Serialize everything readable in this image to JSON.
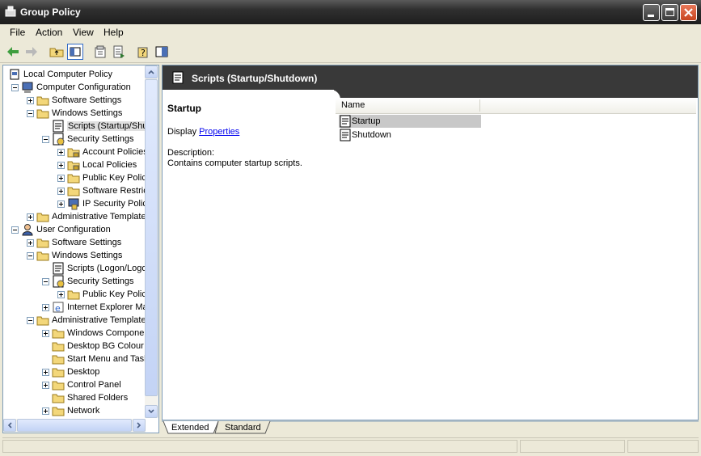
{
  "window": {
    "title": "Group Policy"
  },
  "menu": [
    "File",
    "Action",
    "View",
    "Help"
  ],
  "tree": [
    {
      "label": "Local Computer Policy",
      "icon": "computer-policy-icon",
      "depth": 0,
      "expander": "none"
    },
    {
      "label": "Computer Configuration",
      "icon": "computer-icon",
      "depth": 1,
      "expander": "minus"
    },
    {
      "label": "Software Settings",
      "icon": "folder-icon",
      "depth": 2,
      "expander": "plus"
    },
    {
      "label": "Windows Settings",
      "icon": "folder-icon",
      "depth": 2,
      "expander": "minus"
    },
    {
      "label": "Scripts (Startup/Shutdown)",
      "icon": "script-icon",
      "depth": 3,
      "expander": "none",
      "selected": true
    },
    {
      "label": "Security Settings",
      "icon": "security-icon",
      "depth": 3,
      "expander": "minus"
    },
    {
      "label": "Account Policies",
      "icon": "folder-lock-icon",
      "depth": 4,
      "expander": "plus"
    },
    {
      "label": "Local Policies",
      "icon": "folder-lock-icon",
      "depth": 4,
      "expander": "plus"
    },
    {
      "label": "Public Key Policies",
      "icon": "folder-icon",
      "depth": 4,
      "expander": "plus"
    },
    {
      "label": "Software Restriction Policies",
      "icon": "folder-icon",
      "depth": 4,
      "expander": "plus"
    },
    {
      "label": "IP Security Policies",
      "icon": "ip-security-icon",
      "depth": 4,
      "expander": "plus"
    },
    {
      "label": "Administrative Templates",
      "icon": "folder-icon",
      "depth": 2,
      "expander": "plus"
    },
    {
      "label": "User Configuration",
      "icon": "user-icon",
      "depth": 1,
      "expander": "minus"
    },
    {
      "label": "Software Settings",
      "icon": "folder-icon",
      "depth": 2,
      "expander": "plus"
    },
    {
      "label": "Windows Settings",
      "icon": "folder-icon",
      "depth": 2,
      "expander": "minus"
    },
    {
      "label": "Scripts (Logon/Logoff)",
      "icon": "script-icon",
      "depth": 3,
      "expander": "none"
    },
    {
      "label": "Security Settings",
      "icon": "security-icon",
      "depth": 3,
      "expander": "minus"
    },
    {
      "label": "Public Key Policies",
      "icon": "folder-icon",
      "depth": 4,
      "expander": "plus"
    },
    {
      "label": "Internet Explorer Maintenance",
      "icon": "ie-icon",
      "depth": 3,
      "expander": "plus"
    },
    {
      "label": "Administrative Templates",
      "icon": "folder-icon",
      "depth": 2,
      "expander": "minus"
    },
    {
      "label": "Windows Components",
      "icon": "folder-icon",
      "depth": 3,
      "expander": "plus"
    },
    {
      "label": "Desktop BG Colour",
      "icon": "folder-icon",
      "depth": 3,
      "expander": "none"
    },
    {
      "label": "Start Menu and Taskbar",
      "icon": "folder-icon",
      "depth": 3,
      "expander": "none"
    },
    {
      "label": "Desktop",
      "icon": "folder-icon",
      "depth": 3,
      "expander": "plus"
    },
    {
      "label": "Control Panel",
      "icon": "folder-icon",
      "depth": 3,
      "expander": "plus"
    },
    {
      "label": "Shared Folders",
      "icon": "folder-icon",
      "depth": 3,
      "expander": "none"
    },
    {
      "label": "Network",
      "icon": "folder-icon",
      "depth": 3,
      "expander": "plus"
    }
  ],
  "detail": {
    "header_title": "Scripts (Startup/Shutdown)",
    "section_title": "Startup",
    "display_prefix": "Display",
    "display_link": "Properties",
    "description_label": "Description:",
    "description_text": "Contains computer startup scripts."
  },
  "list": {
    "column_name": "Name",
    "items": [
      {
        "label": "Startup",
        "selected": true
      },
      {
        "label": "Shutdown",
        "selected": false
      }
    ]
  },
  "tabs": [
    "Extended",
    "Standard"
  ],
  "active_tab": "Extended",
  "colors": {
    "title_bar": "#2f2f2f",
    "header_bar": "#393939",
    "link": "#0000ee",
    "selection": "#c8c8c8"
  }
}
